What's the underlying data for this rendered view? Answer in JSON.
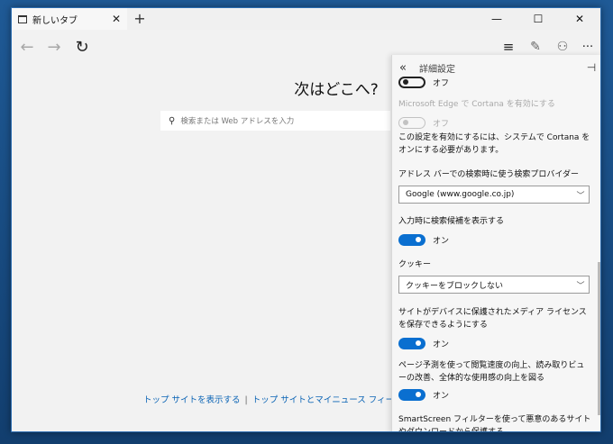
{
  "tab": {
    "title": "新しいタブ",
    "close": "✕",
    "new": "+"
  },
  "window_controls": {
    "minimize": "—",
    "maximize": "☐",
    "close": "✕"
  },
  "nav": {
    "back": "←",
    "forward": "→",
    "refresh": "↻",
    "hub": "≡",
    "note": "✎",
    "share": "⚇",
    "more": "···"
  },
  "ntp": {
    "heading": "次はどこへ?",
    "search_placeholder": "検索または Web アドレスを入力",
    "link_top_sites": "トップ サイトを表示する",
    "separator": "|",
    "link_top_sites_news": "トップ サイトとマイニュース フィードを表"
  },
  "panel": {
    "title": "詳細設定",
    "back": "«",
    "pin": "⊣",
    "first_toggle_text": "オフ",
    "cortana_label": "Microsoft Edge で Cortana を有効にする",
    "cortana_toggle_text": "オフ",
    "cortana_note": "この設定を有効にするには、システムで Cortana をオンにする必要があります。",
    "search_provider_label": "アドレス バーでの検索時に使う検索プロバイダー",
    "search_provider_value": "Google (www.google.co.jp)",
    "suggestions_label": "入力時に検索候補を表示する",
    "suggestions_text": "オン",
    "cookies_label": "クッキー",
    "cookies_value": "クッキーをブロックしない",
    "media_license_label": "サイトがデバイスに保護されたメディア ライセンスを保存できるようにする",
    "media_license_text": "オン",
    "page_prediction_label": "ページ予測を使って閲覧速度の向上、読み取りビューの改善、全体的な使用感の向上を図る",
    "page_prediction_text": "オン",
    "smartscreen_label": "SmartScreen フィルターを使って悪意のあるサイトやダウンロードから保護する"
  }
}
